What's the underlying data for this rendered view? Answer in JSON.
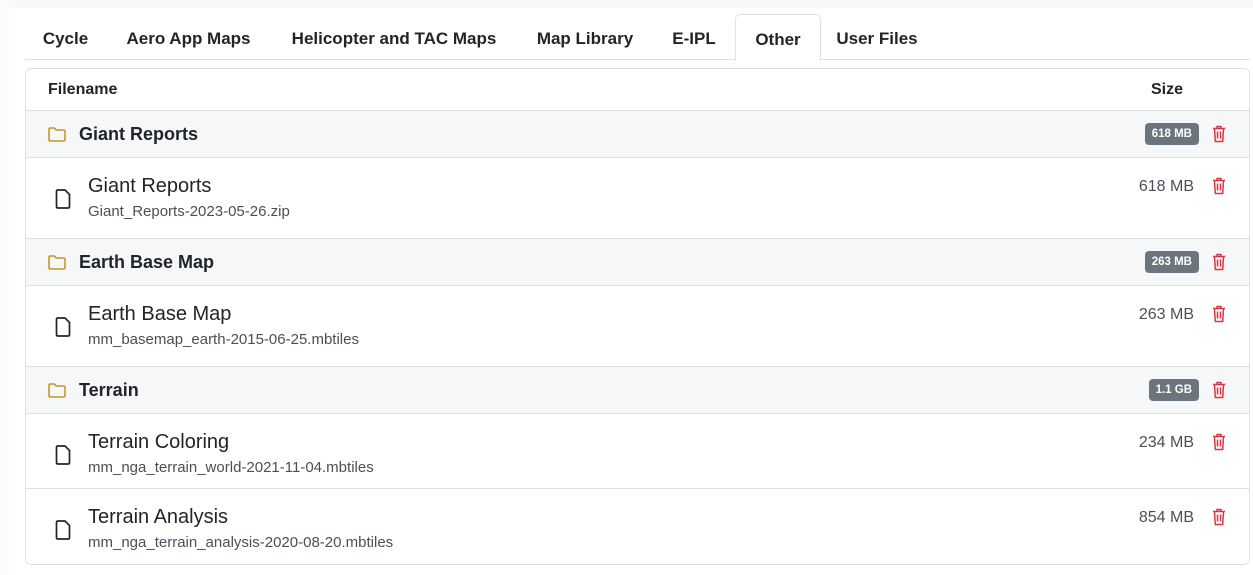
{
  "tabs": [
    {
      "label": "Cycle",
      "active": false
    },
    {
      "label": "Aero App Maps",
      "active": false
    },
    {
      "label": "Helicopter and TAC Maps",
      "active": false
    },
    {
      "label": "Map Library",
      "active": false
    },
    {
      "label": "E-IPL",
      "active": false
    },
    {
      "label": "Other",
      "active": true
    },
    {
      "label": "User Files",
      "active": false
    }
  ],
  "table": {
    "headers": {
      "filename": "Filename",
      "size": "Size"
    },
    "groups": [
      {
        "name": "Giant Reports",
        "total": "618 MB",
        "files": [
          {
            "title": "Giant Reports",
            "filename": "Giant_Reports-2023-05-26.zip",
            "size": "618 MB"
          }
        ]
      },
      {
        "name": "Earth Base Map",
        "total": "263 MB",
        "files": [
          {
            "title": "Earth Base Map",
            "filename": "mm_basemap_earth-2015-06-25.mbtiles",
            "size": "263 MB"
          }
        ]
      },
      {
        "name": "Terrain",
        "total": "1.1 GB",
        "files": [
          {
            "title": "Terrain Coloring",
            "filename": "mm_nga_terrain_world-2021-11-04.mbtiles",
            "size": "234 MB"
          },
          {
            "title": "Terrain Analysis",
            "filename": "mm_nga_terrain_analysis-2020-08-20.mbtiles",
            "size": "854 MB"
          }
        ]
      }
    ]
  },
  "colors": {
    "folder": "#c8942a",
    "trash": "#dc3545",
    "badge": "#6c757d"
  },
  "icons": {
    "folder": "folder-icon",
    "file": "file-icon",
    "delete": "trash-icon"
  }
}
